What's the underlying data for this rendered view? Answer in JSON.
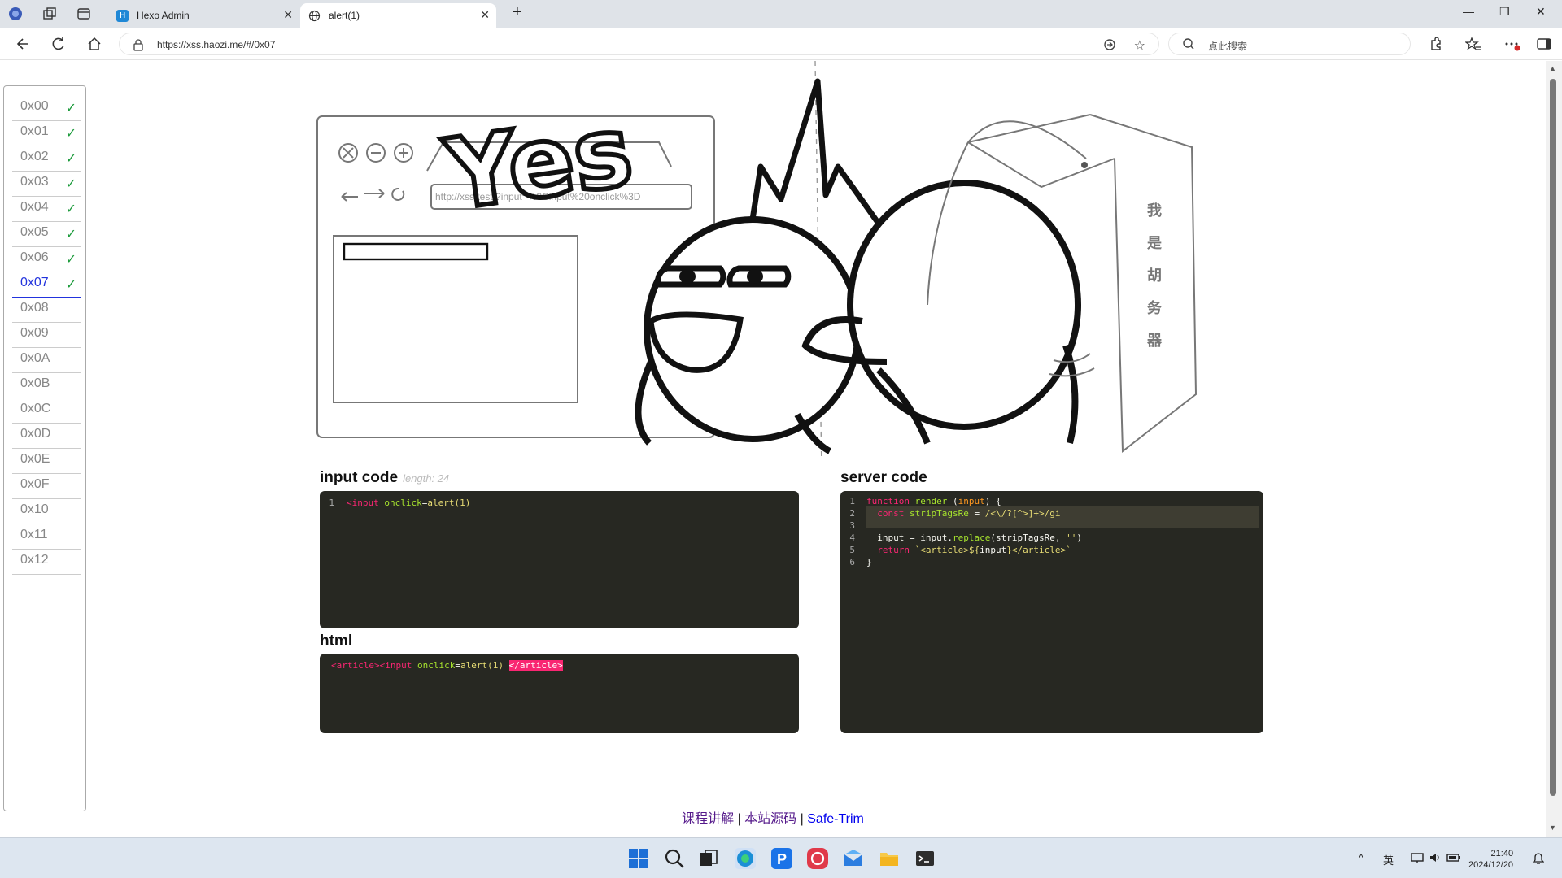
{
  "browser": {
    "tabs": [
      {
        "title": "Hexo Admin",
        "favicon": "H",
        "active": false
      },
      {
        "title": "alert(1)",
        "favicon": "globe-icon",
        "active": true
      }
    ],
    "url": "https://xss.haozi.me/#/0x07",
    "search_placeholder": "点此搜索"
  },
  "sidebar": {
    "levels": [
      {
        "label": "0x00",
        "done": true
      },
      {
        "label": "0x01",
        "done": true
      },
      {
        "label": "0x02",
        "done": true
      },
      {
        "label": "0x03",
        "done": true
      },
      {
        "label": "0x04",
        "done": true
      },
      {
        "label": "0x05",
        "done": true
      },
      {
        "label": "0x06",
        "done": true
      },
      {
        "label": "0x07",
        "done": true,
        "current": true
      },
      {
        "label": "0x08",
        "done": false
      },
      {
        "label": "0x09",
        "done": false
      },
      {
        "label": "0x0A",
        "done": false
      },
      {
        "label": "0x0B",
        "done": false
      },
      {
        "label": "0x0C",
        "done": false
      },
      {
        "label": "0x0D",
        "done": false
      },
      {
        "label": "0x0E",
        "done": false
      },
      {
        "label": "0x0F",
        "done": false
      },
      {
        "label": "0x10",
        "done": false
      },
      {
        "label": "0x11",
        "done": false
      },
      {
        "label": "0x12",
        "done": false
      }
    ],
    "check_mark": "✓"
  },
  "hero": {
    "yes_text": "Yes",
    "fake_url": "http://xss.test/?input=%3Cinput%20onclick%3D",
    "box_text": [
      "我",
      "是",
      "胡",
      "务",
      "器"
    ]
  },
  "input_panel": {
    "title": "input code",
    "length_label": "length: 24",
    "line_number": "1",
    "code_tag": "<input",
    "code_attr": "onclick",
    "code_eq": "=",
    "code_val": "alert(1)"
  },
  "html_panel": {
    "title": "html",
    "open_article": "<article>",
    "input_tag": "<input",
    "attr": "onclick",
    "eq": "=",
    "val": "alert(1)",
    "close_article": "</article>"
  },
  "server_panel": {
    "title": "server code",
    "lines": [
      {
        "n": "1",
        "parts": [
          [
            "kw",
            "function"
          ],
          [
            "",
            " "
          ],
          [
            "fn",
            "render"
          ],
          [
            "",
            " ("
          ],
          [
            "vr",
            "input"
          ],
          [
            "",
            ") {"
          ]
        ]
      },
      {
        "n": "2",
        "parts": [
          [
            "",
            "  "
          ],
          [
            "kw",
            "const"
          ],
          [
            "",
            " "
          ],
          [
            "fn",
            "stripTagsRe"
          ],
          [
            "",
            " = "
          ],
          [
            "st",
            "/<\\/?[^>]+>/gi"
          ]
        ]
      },
      {
        "n": "3",
        "parts": [
          [
            "",
            ""
          ]
        ]
      },
      {
        "n": "4",
        "parts": [
          [
            "",
            "  "
          ],
          [
            "",
            "input"
          ],
          [
            "",
            " = "
          ],
          [
            "",
            "input"
          ],
          [
            "",
            "."
          ],
          [
            "fn",
            "replace"
          ],
          [
            "",
            "(stripTagsRe, "
          ],
          [
            "st",
            "''"
          ],
          [
            "",
            ")"
          ]
        ]
      },
      {
        "n": "5",
        "parts": [
          [
            "",
            "  "
          ],
          [
            "kw",
            "return"
          ],
          [
            "",
            " "
          ],
          [
            "st",
            "`<article>${"
          ],
          [
            "",
            "input"
          ],
          [
            "st",
            "}</article>`"
          ]
        ]
      },
      {
        "n": "6",
        "parts": [
          [
            "",
            "}"
          ]
        ]
      }
    ]
  },
  "footer": {
    "link1": "课程讲解",
    "sep": "|",
    "link2": "本站源码",
    "link3": "Safe-Trim",
    "link1_color": "#551a8b",
    "link2_color": "#551a8b",
    "link3_color": "#0000ee"
  },
  "taskbar": {
    "ime": "英",
    "time": "21:40",
    "date": "2024/12/20"
  }
}
